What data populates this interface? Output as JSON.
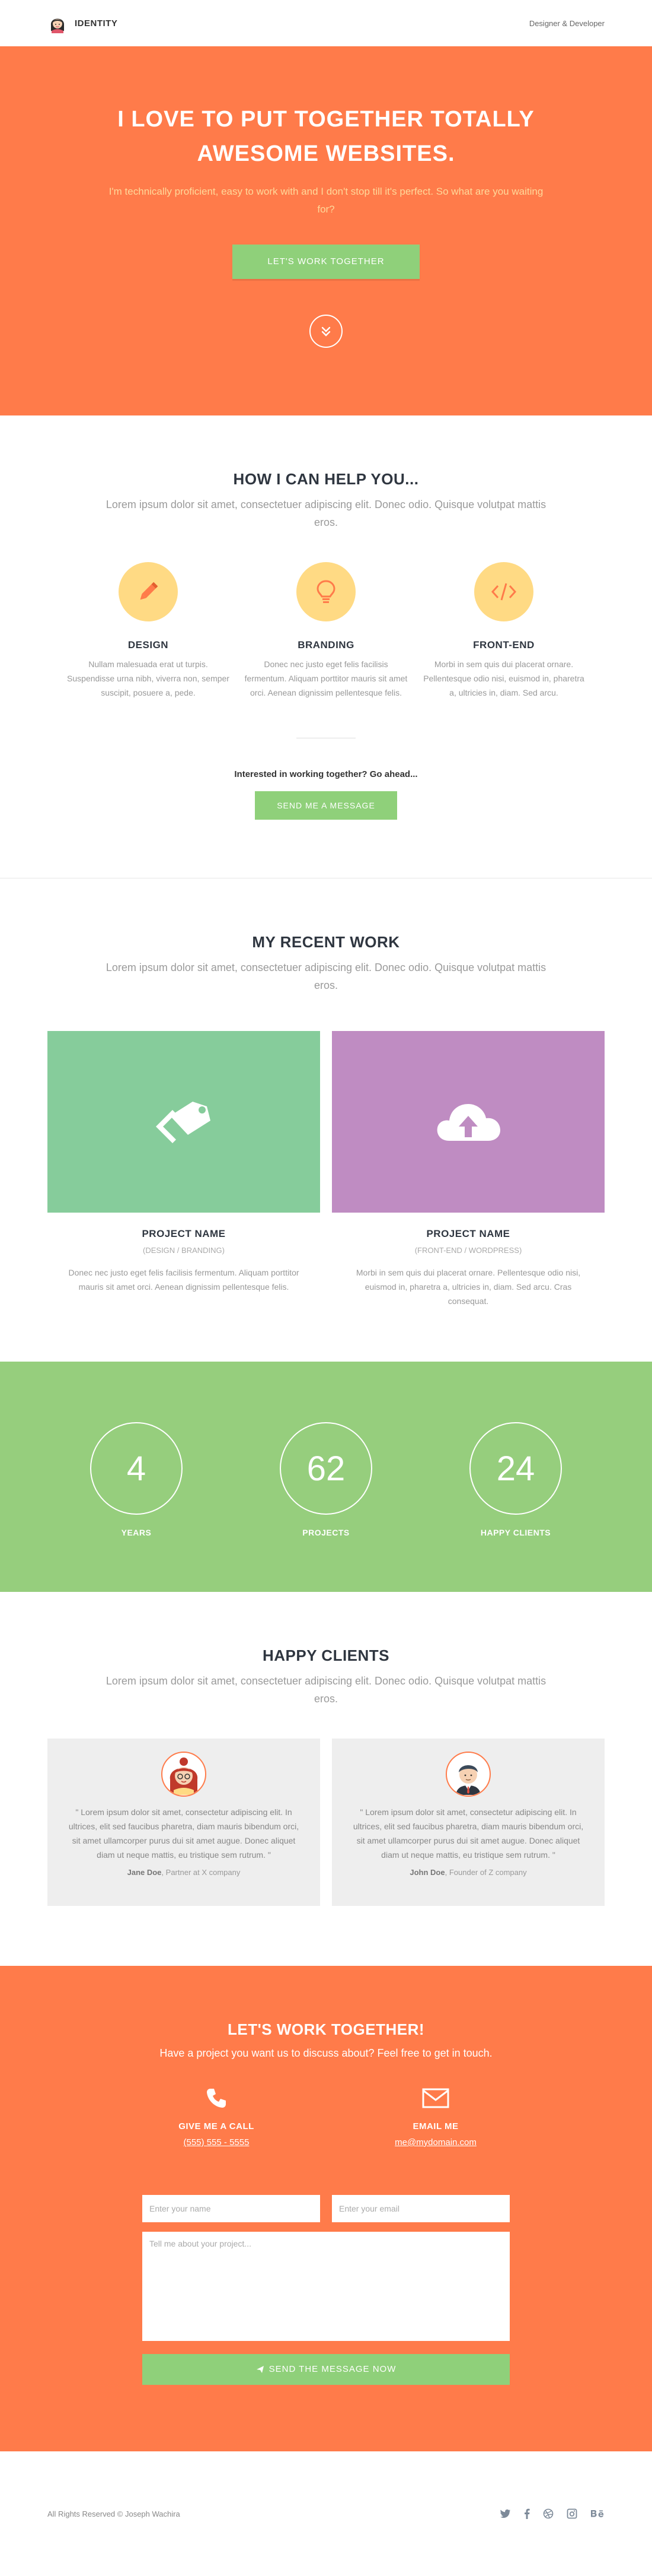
{
  "header": {
    "brand": "IDENTITY",
    "tagline": "Designer & Developer"
  },
  "hero": {
    "title": "I LOVE TO PUT TOGETHER TOTALLY AWESOME WEBSITES.",
    "subtitle": "I'm technically proficient, easy to work with and I don't stop till it's perfect. So what are you waiting for?",
    "button": "LET'S WORK TOGETHER"
  },
  "services": {
    "title": "HOW I CAN HELP YOU...",
    "subtitle": "Lorem ipsum dolor sit amet, consectetuer adipiscing elit. Donec odio. Quisque volutpat mattis eros.",
    "items": [
      {
        "icon": "pencil-icon",
        "title": "DESIGN",
        "text": "Nullam malesuada erat ut turpis. Suspendisse urna nibh, viverra non, semper suscipit, posuere a, pede."
      },
      {
        "icon": "lightbulb-icon",
        "title": "BRANDING",
        "text": "Donec nec justo eget felis facilisis fermentum. Aliquam porttitor mauris sit amet orci. Aenean dignissim pellentesque felis."
      },
      {
        "icon": "code-icon",
        "title": "FRONT-END",
        "text": "Morbi in sem quis dui placerat ornare. Pellentesque odio nisi, euismod in, pharetra a, ultricies in, diam. Sed arcu."
      }
    ],
    "cta_text": "Interested in working together? Go ahead...",
    "cta_button": "SEND ME A MESSAGE"
  },
  "work": {
    "title": "MY RECENT WORK",
    "subtitle": "Lorem ipsum dolor sit amet, consectetuer adipiscing elit. Donec odio. Quisque volutpat mattis eros.",
    "items": [
      {
        "name": "PROJECT NAME",
        "category": "(DESIGN / BRANDING)",
        "text": "Donec nec justo eget felis facilisis fermentum. Aliquam porttitor mauris sit amet orci. Aenean dignissim pellentesque felis.",
        "color": "#86cc9b",
        "icon": "tags-icon"
      },
      {
        "name": "PROJECT NAME",
        "category": "(FRONT-END / WORDPRESS)",
        "text": "Morbi in sem quis dui placerat ornare. Pellentesque odio nisi, euismod in, pharetra a, ultricies in, diam. Sed arcu. Cras consequat.",
        "color": "#bf8cc2",
        "icon": "cloud-upload-icon"
      }
    ]
  },
  "stats": [
    {
      "value": "4",
      "label": "YEARS"
    },
    {
      "value": "62",
      "label": "PROJECTS"
    },
    {
      "value": "24",
      "label": "HAPPY CLIENTS"
    }
  ],
  "clients": {
    "title": "HAPPY CLIENTS",
    "subtitle": "Lorem ipsum dolor sit amet, consectetuer adipiscing elit. Donec odio. Quisque volutpat mattis eros.",
    "items": [
      {
        "quote": "\" Lorem ipsum dolor sit amet, consectetur adipiscing elit. In ultrices, elit sed faucibus pharetra, diam mauris bibendum orci, sit amet ullamcorper purus dui sit amet augue. Donec aliquet diam ut neque mattis, eu tristique sem rutrum. \"",
        "name": "Jane Doe",
        "role": ", Partner at X company"
      },
      {
        "quote": "\" Lorem ipsum dolor sit amet, consectetur adipiscing elit. In ultrices, elit sed faucibus pharetra, diam mauris bibendum orci, sit amet ullamcorper purus dui sit amet augue. Donec aliquet diam ut neque mattis, eu tristique sem rutrum. \"",
        "name": "John Doe",
        "role": ", Founder of Z company"
      }
    ]
  },
  "contact": {
    "title": "LET'S WORK TOGETHER!",
    "lead": "Have a project you want us to discuss about? Feel free to get in touch.",
    "call_title": "GIVE ME A CALL",
    "call_value": "(555) 555 - 5555",
    "email_title": "EMAIL ME",
    "email_value": "me@mydomain.com",
    "name_placeholder": "Enter your name",
    "email_placeholder": "Enter your email",
    "message_placeholder": "Tell me about your project...",
    "send_button": "SEND THE MESSAGE NOW"
  },
  "footer": {
    "copyright": "All Rights Reserved © Joseph Wachira",
    "socials": [
      "twitter-icon",
      "facebook-icon",
      "dribbble-icon",
      "instagram-icon",
      "behance-icon"
    ]
  },
  "colors": {
    "accent_orange": "#ff7b4a",
    "accent_green": "#96ce7d",
    "icon_yellow": "#ffda84",
    "dark_text": "#2f3640"
  }
}
